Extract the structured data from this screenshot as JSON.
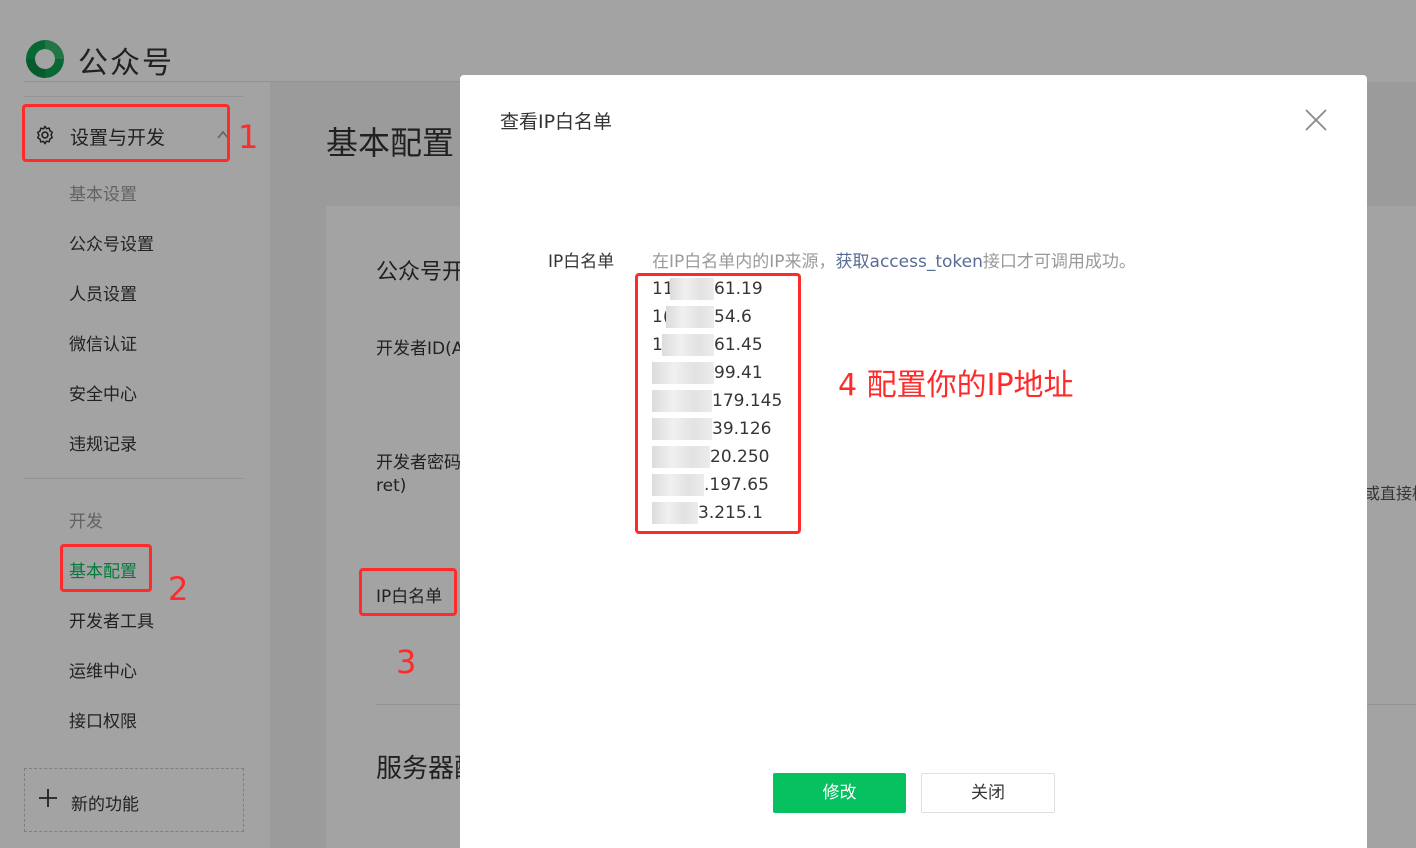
{
  "app": {
    "brand": "公众号"
  },
  "sidebar": {
    "parent_label": "设置与开发",
    "group_settings_label": "基本设置",
    "settings_items": [
      {
        "label": "公众号设置"
      },
      {
        "label": "人员设置"
      },
      {
        "label": "微信认证"
      },
      {
        "label": "安全中心"
      },
      {
        "label": "违规记录"
      }
    ],
    "group_dev_label": "开发",
    "dev_items": [
      {
        "label": "基本配置",
        "active": true
      },
      {
        "label": "开发者工具"
      },
      {
        "label": "运维中心"
      },
      {
        "label": "接口权限"
      }
    ],
    "new_feature_label": "新的功能"
  },
  "main": {
    "title": "基本配置",
    "section1_title": "公众号开",
    "appid_label": "开发者ID(A",
    "secret_label_line1": "开发者密码",
    "secret_label_line2": "ret)",
    "ipwhitelist_label": "IP白名单",
    "right_snippet": "或直接核",
    "section2_title": "服务器配"
  },
  "modal": {
    "title": "查看IP白名单",
    "field_label": "IP白名单",
    "tip_prefix": "在IP白名单内的IP来源，",
    "tip_link": "获取access_token",
    "tip_suffix": "接口才可调用成功。",
    "ips": [
      {
        "head": "11",
        "tail": "61.19"
      },
      {
        "head": "1(",
        "tail": "54.6"
      },
      {
        "head": "1",
        "tail": "61.45"
      },
      {
        "head": "",
        "tail": "99.41"
      },
      {
        "head": "",
        "tail": "179.145"
      },
      {
        "head": "",
        "tail": "39.126"
      },
      {
        "head": "",
        "tail": "20.250"
      },
      {
        "head": "",
        "tail": ".197.65"
      },
      {
        "head": "",
        "tail": "3.215.1"
      }
    ],
    "edit_button": "修改",
    "close_button": "关闭"
  },
  "annotations": {
    "n1": "1",
    "n2": "2",
    "n3": "3",
    "n4_text": "4 配置你的IP地址",
    "color": "#ff2a2a"
  },
  "colors": {
    "accent": "#07c160",
    "link": "#576b95",
    "annotation": "#ff2a2a"
  },
  "icons": [
    "logo-icon",
    "gear-icon",
    "chevron-up-icon",
    "plus-icon",
    "close-icon"
  ]
}
